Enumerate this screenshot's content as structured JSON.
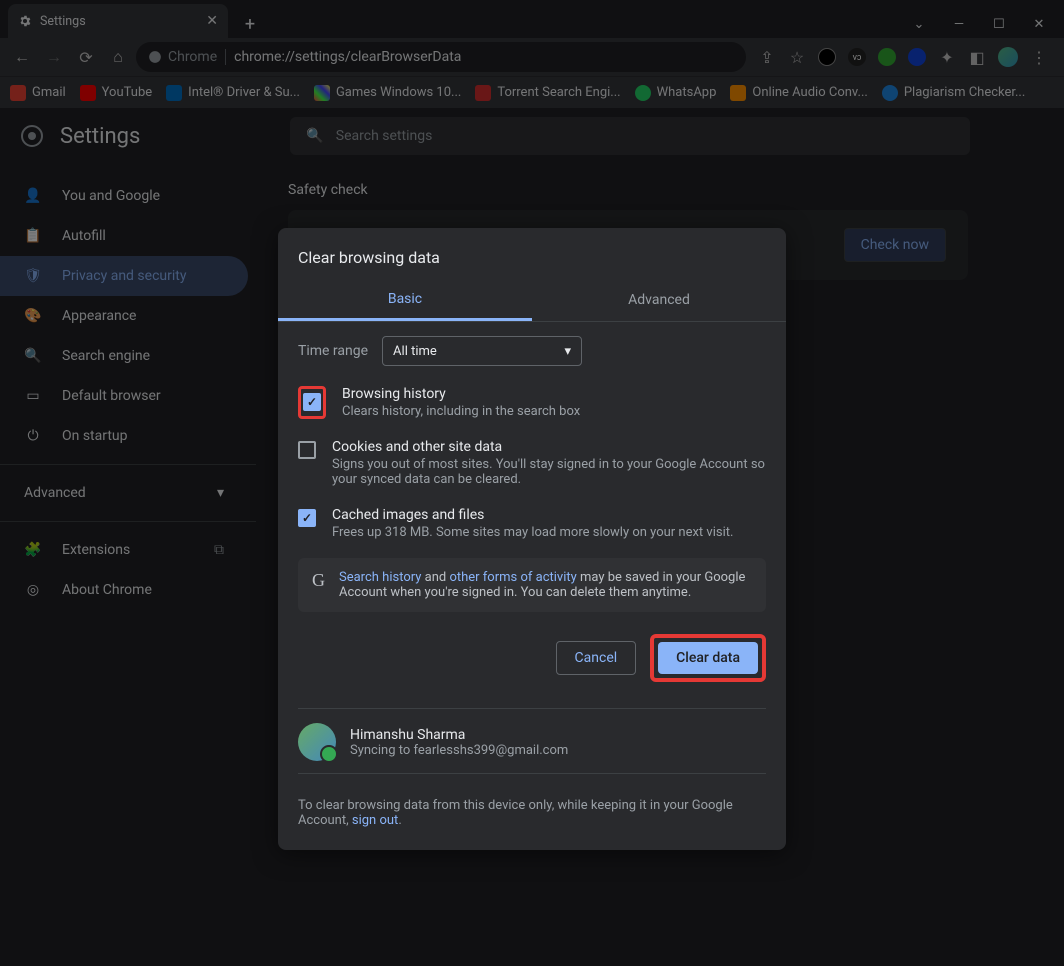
{
  "window": {
    "tab_title": "Settings"
  },
  "omnibox": {
    "chip": "Chrome",
    "url": "chrome://settings/clearBrowserData"
  },
  "bookmarks": [
    {
      "label": "Gmail",
      "color": "#ea4335"
    },
    {
      "label": "YouTube",
      "color": "#ff0000"
    },
    {
      "label": "Intel® Driver & Su...",
      "color": "#0071c5"
    },
    {
      "label": "Games Windows 10...",
      "color": "#ffb400"
    },
    {
      "label": "Torrent Search Engi...",
      "color": "#d32f2f"
    },
    {
      "label": "WhatsApp",
      "color": "#25d366"
    },
    {
      "label": "Online Audio Conv...",
      "color": "#ff9100"
    },
    {
      "label": "Plagiarism Checker...",
      "color": "#1e88e5"
    }
  ],
  "settings_header": {
    "title": "Settings",
    "search_placeholder": "Search settings"
  },
  "sidebar": {
    "items": [
      {
        "label": "You and Google",
        "icon": "person"
      },
      {
        "label": "Autofill",
        "icon": "clipboard"
      },
      {
        "label": "Privacy and security",
        "icon": "shield",
        "active": true
      },
      {
        "label": "Appearance",
        "icon": "palette"
      },
      {
        "label": "Search engine",
        "icon": "search"
      },
      {
        "label": "Default browser",
        "icon": "browser"
      },
      {
        "label": "On startup",
        "icon": "power"
      }
    ],
    "advanced": "Advanced",
    "extensions": "Extensions",
    "about": "About Chrome"
  },
  "content": {
    "safety_check": "Safety check",
    "check_now": "Check now"
  },
  "dialog": {
    "title": "Clear browsing data",
    "tabs": {
      "basic": "Basic",
      "advanced": "Advanced"
    },
    "time_range_label": "Time range",
    "time_range_value": "All time",
    "options": [
      {
        "label": "Browsing history",
        "sub": "Clears history, including in the search box",
        "checked": true,
        "highlight": true
      },
      {
        "label": "Cookies and other site data",
        "sub": "Signs you out of most sites. You'll stay signed in to your Google Account so your synced data can be cleared.",
        "checked": false
      },
      {
        "label": "Cached images and files",
        "sub": "Frees up 318 MB. Some sites may load more slowly on your next visit.",
        "checked": true
      }
    ],
    "info_pre": "Search history",
    "info_mid": " and ",
    "info_link2": "other forms of activity",
    "info_post": " may be saved in your Google Account when you're signed in. You can delete them anytime.",
    "cancel": "Cancel",
    "clear": "Clear data",
    "account_name": "Himanshu Sharma",
    "account_sync": "Syncing to fearlesshs399@gmail.com",
    "footnote_pre": "To clear browsing data from this device only, while keeping it in your Google Account, ",
    "footnote_link": "sign out",
    "footnote_post": "."
  }
}
